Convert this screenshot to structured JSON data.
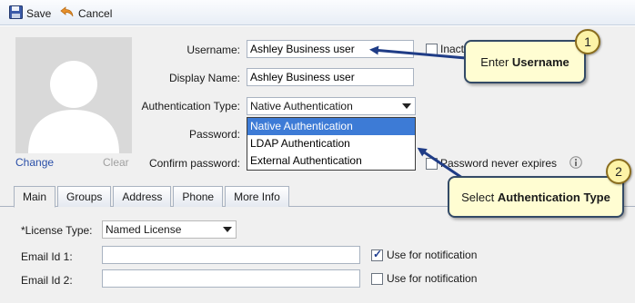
{
  "toolbar": {
    "save_label": "Save",
    "cancel_label": "Cancel"
  },
  "profile": {
    "change_label": "Change",
    "clear_label": "Clear"
  },
  "form": {
    "username_label": "Username:",
    "username_value": "Ashley Business user",
    "inactive_label": "Inact",
    "display_name_label": "Display Name:",
    "display_name_value": "Ashley Business user",
    "auth_type_label": "Authentication Type:",
    "auth_type_value": "Native Authentication",
    "password_label": "Password:",
    "confirm_password_label": "Confirm password:",
    "password_never_expires_label": "Password never expires"
  },
  "auth_options": [
    "Native Authentication",
    "LDAP Authentication",
    "External Authentication"
  ],
  "tabs": [
    {
      "label": "Main"
    },
    {
      "label": "Groups"
    },
    {
      "label": "Address"
    },
    {
      "label": "Phone"
    },
    {
      "label": "More Info"
    }
  ],
  "main_tab": {
    "license_type_label": "*License Type:",
    "license_type_value": "Named License",
    "email1_label": "Email Id 1:",
    "email1_value": "",
    "email1_notify_label": "Use for notification",
    "email1_notify_checked": true,
    "email2_label": "Email Id 2:",
    "email2_value": "",
    "email2_notify_label": "Use for notification",
    "email2_notify_checked": false
  },
  "callouts": [
    {
      "number": "1",
      "prefix": "Enter ",
      "bold": "Username"
    },
    {
      "number": "2",
      "prefix": "Select ",
      "bold": "Authentication Type"
    }
  ],
  "colors": {
    "callout_fill": "#fffdd2",
    "callout_border": "#334a66",
    "selection": "#3d7bd6",
    "link": "#2a4fa8"
  }
}
